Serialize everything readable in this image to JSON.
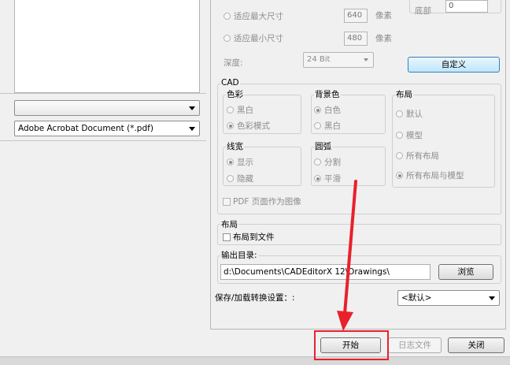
{
  "left": {
    "combo_empty": "",
    "file_type": "Adobe Acrobat Document (*.pdf)"
  },
  "size": {
    "fit_max_label": "适应最大尺寸",
    "fit_max_value": "640",
    "fit_min_label": "适应最小尺寸",
    "fit_min_value": "480",
    "unit_pixel": "像素",
    "depth_label": "深度:",
    "depth_value": "24 Bit",
    "bottom_label": "底部",
    "bottom_value": "0",
    "custom_button": "自定义"
  },
  "cad": {
    "title": "CAD",
    "color": {
      "title": "色彩",
      "options": [
        "黑白",
        "色彩模式"
      ],
      "selected": 1
    },
    "background": {
      "title": "背景色",
      "options": [
        "白色",
        "黑白"
      ],
      "selected": 0
    },
    "linewidth": {
      "title": "线宽",
      "options": [
        "显示",
        "隐藏"
      ],
      "selected": 0
    },
    "arc": {
      "title": "圆弧",
      "options": [
        "分割",
        "平滑"
      ],
      "selected": 1
    },
    "layout": {
      "title": "布局",
      "options": [
        "默认",
        "模型",
        "所有布局",
        "所有布局与模型"
      ],
      "selected": 3
    },
    "pdf_as_image": "PDF 页面作为图像"
  },
  "layout_group": {
    "title": "布局",
    "layout_to_file": "布局到文件"
  },
  "output": {
    "label": "输出目录:",
    "path": "d:\\Documents\\CADEditorX 12\\Drawings\\",
    "browse": "浏览"
  },
  "save_load": {
    "label": "保存/加载转换设置：:",
    "value": "<默认>"
  },
  "footer": {
    "start": "开始",
    "log": "日志文件",
    "close": "关闭"
  },
  "colors": {
    "highlight": "#e8212c",
    "annotation_arrow": "#e8212c"
  }
}
